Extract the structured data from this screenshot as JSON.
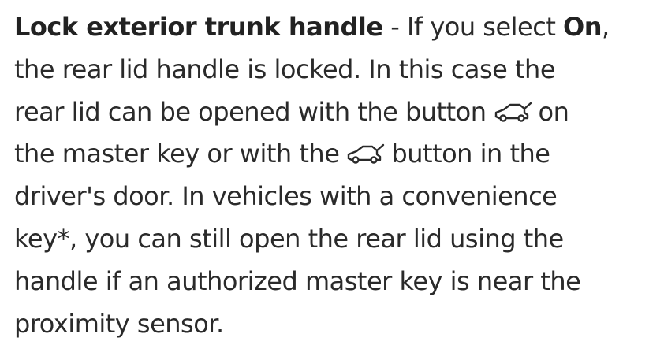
{
  "paragraph": {
    "heading": "Lock exterior trunk handle",
    "line1_sep": " - If you select ",
    "line1_on": "On",
    "line1_end": ",",
    "line2": "the rear lid handle is locked. In this case the",
    "line3_start": "rear lid can be opened with the button",
    "line3_end": "on",
    "line4_start": "the master key or with the",
    "line4_end": "button in the",
    "line5": "driver's door. In vehicles with a convenience",
    "line6": "key*, you can still open the rear lid using the",
    "line7": "handle if an authorized master key is near the",
    "line8": "proximity sensor.",
    "icons": [
      "car-trunk-open-icon",
      "car-trunk-open-icon"
    ]
  }
}
